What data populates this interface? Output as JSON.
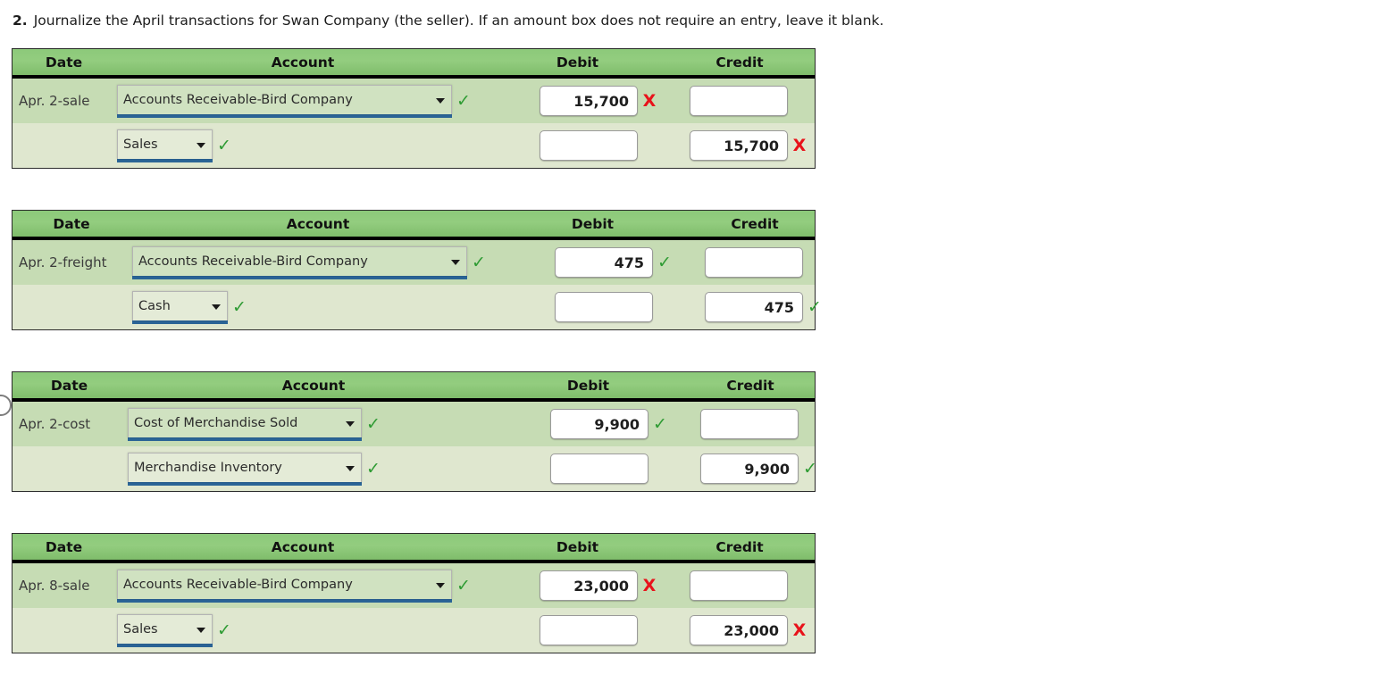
{
  "prompt": {
    "number": "2.",
    "text": "Journalize the April transactions for Swan Company (the seller). If an amount box does not require an entry, leave it blank."
  },
  "columns": {
    "date": "Date",
    "account": "Account",
    "debit": "Debit",
    "credit": "Credit"
  },
  "marks": {
    "correct": "✓",
    "incorrect": "X"
  },
  "journals": [
    {
      "id": "journal-apr-2-sale",
      "rows": [
        {
          "date": "Apr. 2-sale",
          "account": "Accounts Receivable-Bird Company",
          "account_mark": "correct",
          "debit": "15,700",
          "debit_mark": "incorrect",
          "credit": "",
          "credit_mark": "none"
        },
        {
          "date": "",
          "account": "Sales",
          "account_mark": "correct",
          "debit": "",
          "debit_mark": "none",
          "credit": "15,700",
          "credit_mark": "incorrect"
        }
      ]
    },
    {
      "id": "journal-apr-2-freight",
      "rows": [
        {
          "date": "Apr. 2-freight",
          "account": "Accounts Receivable-Bird Company",
          "account_mark": "correct",
          "debit": "475",
          "debit_mark": "correct",
          "credit": "",
          "credit_mark": "none"
        },
        {
          "date": "",
          "account": "Cash",
          "account_mark": "correct",
          "debit": "",
          "debit_mark": "none",
          "credit": "475",
          "credit_mark": "correct"
        }
      ]
    },
    {
      "id": "journal-apr-2-cost",
      "rows": [
        {
          "date": "Apr. 2-cost",
          "account": "Cost of Merchandise Sold",
          "account_mark": "correct",
          "debit": "9,900",
          "debit_mark": "correct",
          "credit": "",
          "credit_mark": "none"
        },
        {
          "date": "",
          "account": "Merchandise Inventory",
          "account_mark": "correct",
          "debit": "",
          "debit_mark": "none",
          "credit": "9,900",
          "credit_mark": "correct"
        }
      ]
    },
    {
      "id": "journal-apr-8-sale",
      "rows": [
        {
          "date": "Apr. 8-sale",
          "account": "Accounts Receivable-Bird Company",
          "account_mark": "correct",
          "debit": "23,000",
          "debit_mark": "incorrect",
          "credit": "",
          "credit_mark": "none"
        },
        {
          "date": "",
          "account": "Sales",
          "account_mark": "correct",
          "debit": "",
          "debit_mark": "none",
          "credit": "23,000",
          "credit_mark": "incorrect"
        }
      ]
    }
  ],
  "layout": {
    "tops": [
      54,
      235,
      416,
      597
    ],
    "date_widths": [
      115,
      132,
      127,
      115
    ],
    "select_widths": [
      [
        "wide",
        "narrow"
      ],
      [
        "wide",
        "narrow"
      ],
      [
        "mid",
        "mid"
      ],
      [
        "wide",
        "narrow"
      ]
    ],
    "header_label_offsets": [
      0,
      0,
      0,
      0
    ]
  },
  "colors": {
    "header_green": "#8cc97a",
    "row_dark": "#c6dcb4",
    "row_light": "#dfe7cf",
    "underline_blue": "#2a6496",
    "check_green": "#2e9b33",
    "x_red": "#e8121a"
  }
}
